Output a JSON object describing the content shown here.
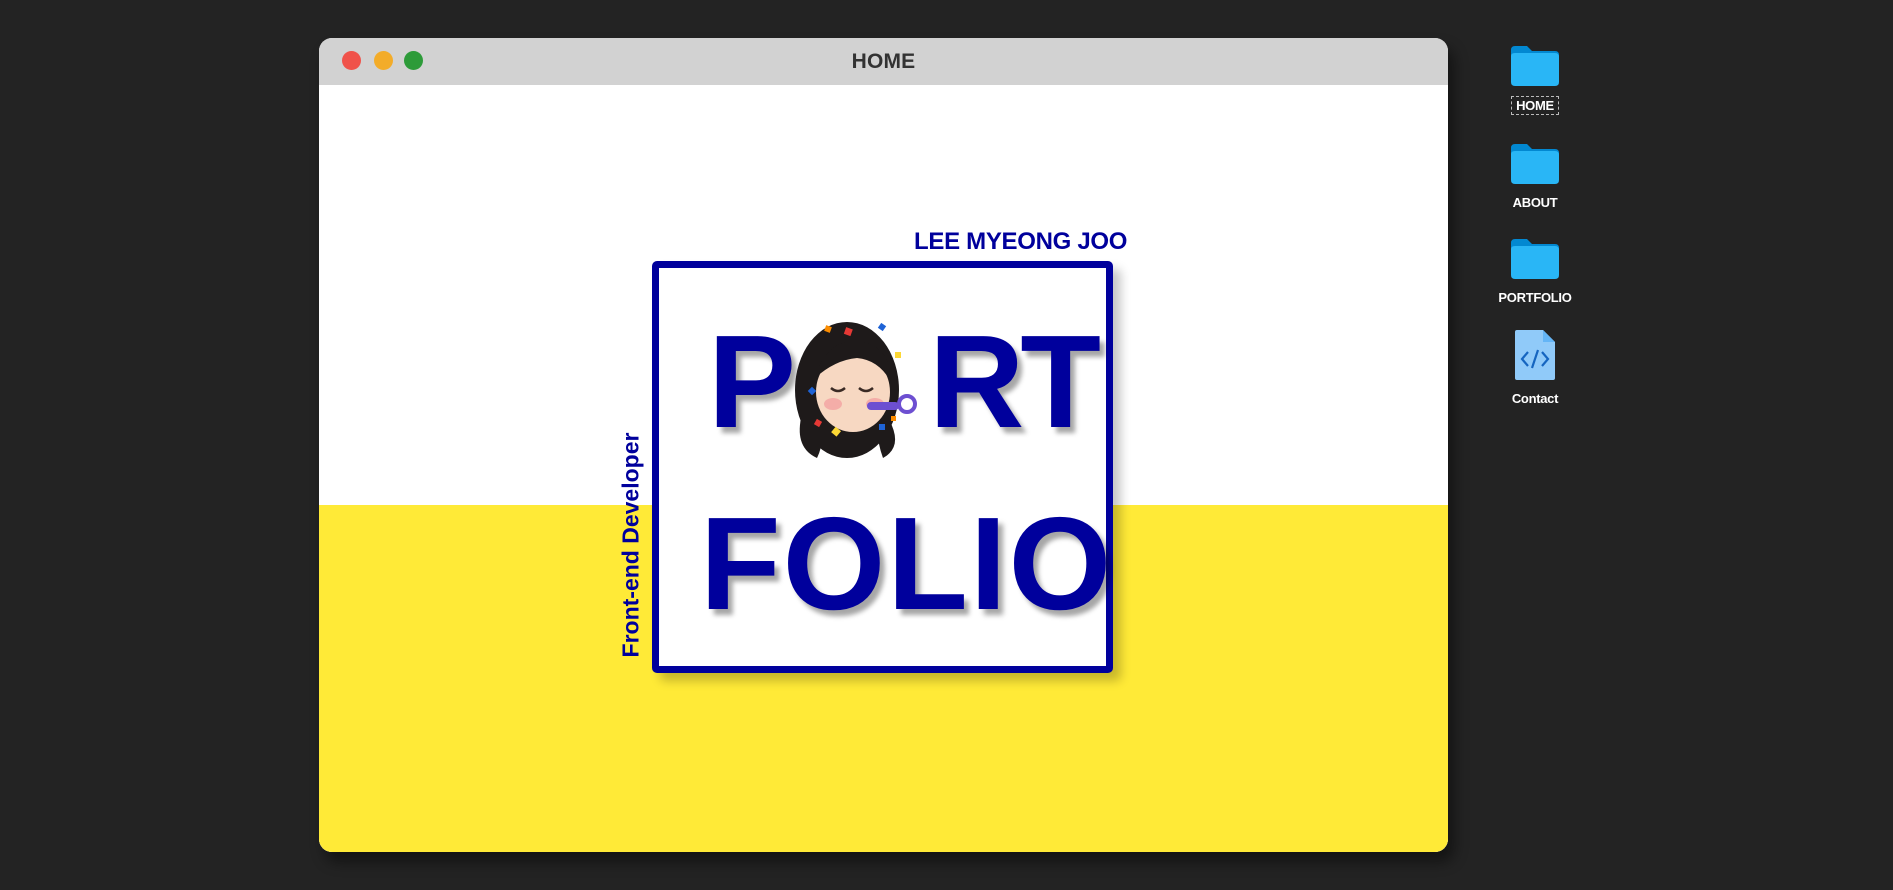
{
  "window": {
    "title": "HOME"
  },
  "hero": {
    "name": "LEE MYEONG JOO",
    "role": "Front-end Developer",
    "word_p": "P",
    "word_rt": "RT",
    "word_folio": "FOLIO",
    "avatar_icon": "memoji-party-avatar-icon"
  },
  "colors": {
    "desktop_bg": "#232323",
    "titlebar": "#d2d2d2",
    "accent_blue": "#00009c",
    "yellow": "#ffea37",
    "folder_blue": "#29b6f6"
  },
  "desktop_icons": [
    {
      "label": "HOME",
      "icon": "folder-icon",
      "selected": true
    },
    {
      "label": "ABOUT",
      "icon": "folder-icon",
      "selected": false
    },
    {
      "label": "PORTFOLIO",
      "icon": "folder-icon",
      "selected": false
    },
    {
      "label": "Contact",
      "icon": "code-file-icon",
      "selected": false
    }
  ]
}
